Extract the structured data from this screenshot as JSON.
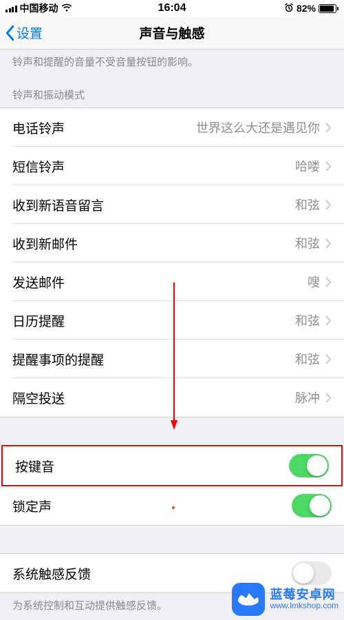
{
  "status": {
    "carrier": "中国移动",
    "time": "16:04",
    "battery_pct": "82%"
  },
  "nav": {
    "back": "设置",
    "title": "声音与触感"
  },
  "top_desc": "铃声和提醒的音量不受音量按钮的影响。",
  "section_ringtone_header": "铃声和振动模式",
  "rows": {
    "ringtone": {
      "label": "电话铃声",
      "value": "世界这么大还是遇见你"
    },
    "text_tone": {
      "label": "短信铃声",
      "value": "哈喽"
    },
    "voicemail": {
      "label": "收到新语音留言",
      "value": "和弦"
    },
    "new_mail": {
      "label": "收到新邮件",
      "value": "和弦"
    },
    "sent_mail": {
      "label": "发送邮件",
      "value": "嗖"
    },
    "calendar": {
      "label": "日历提醒",
      "value": "和弦"
    },
    "reminders": {
      "label": "提醒事项的提醒",
      "value": "和弦"
    },
    "airdrop": {
      "label": "隔空投送",
      "value": "脉冲"
    }
  },
  "toggles": {
    "keyboard_clicks": {
      "label": "按键音",
      "on": true
    },
    "lock_sound": {
      "label": "锁定声",
      "on": true
    },
    "system_haptics": {
      "label": "系统触感反馈",
      "on": false
    }
  },
  "haptics_desc": "为系统控制和互动提供触感反馈。",
  "watermark": {
    "cn": "蓝莓安卓网",
    "url": "www.lmkshop.com"
  }
}
